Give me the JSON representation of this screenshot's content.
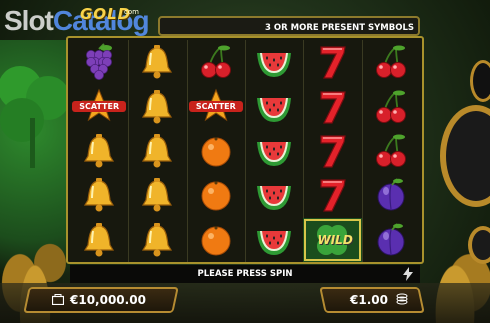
{
  "watermark": {
    "part1": "Slot",
    "part2": "Catalog"
  },
  "logo": {
    "name": "GOLD",
    "suffix": "com"
  },
  "info_bar": {
    "text": "3 OR MORE PRESENT SYMBOLS"
  },
  "reels": [
    [
      "grapes",
      "scatter",
      "bell",
      "bell",
      "bell"
    ],
    [
      "bell",
      "bell",
      "bell",
      "bell",
      "bell"
    ],
    [
      "cherries",
      "scatter",
      "orange",
      "orange",
      "orange"
    ],
    [
      "watermelon",
      "watermelon",
      "watermelon",
      "watermelon",
      "watermelon"
    ],
    [
      "seven",
      "seven",
      "seven",
      "seven",
      "wild"
    ],
    [
      "cherries",
      "cherries",
      "cherries",
      "plum",
      "plum"
    ]
  ],
  "symbol_labels": {
    "scatter": "SCATTER",
    "wild": "WILD"
  },
  "message": "PLEASE PRESS SPIN",
  "balance": {
    "value": "€10,000.00",
    "icon": "wallet-icon"
  },
  "bet": {
    "value": "€1.00",
    "icon": "coin-stack-icon"
  },
  "colors": {
    "frame": "#a8922c",
    "scatter_badge": "#c8231c",
    "wild_bg": "#1b4d1d"
  }
}
